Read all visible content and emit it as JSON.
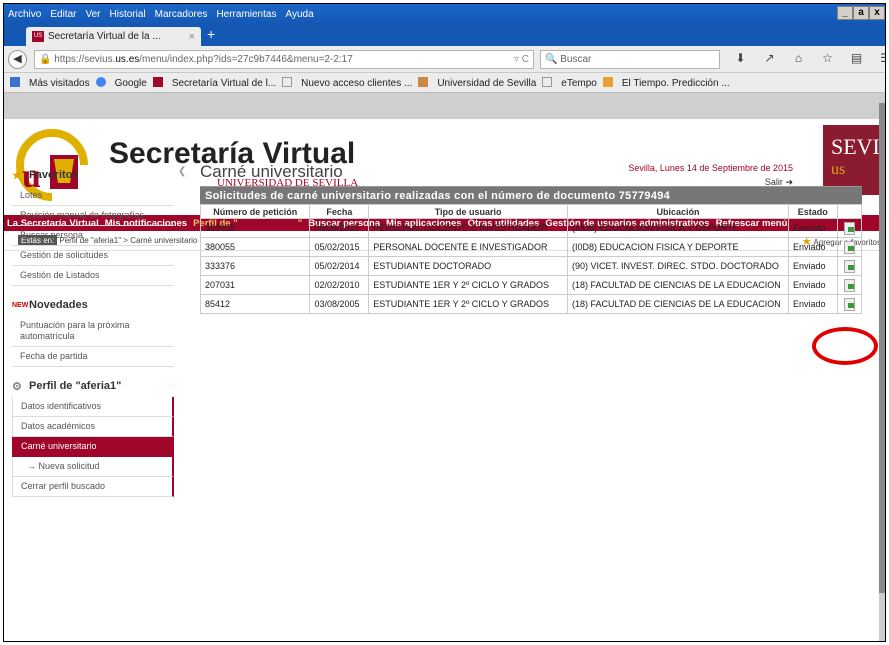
{
  "menubar": {
    "items": [
      "Archivo",
      "Editar",
      "Ver",
      "Historial",
      "Marcadores",
      "Herramientas",
      "Ayuda"
    ],
    "controls": [
      "_",
      "a",
      "x"
    ]
  },
  "tab": {
    "title": "Secretaría Virtual de la ...",
    "close": "×",
    "new": "+"
  },
  "nav": {
    "url_host": "https://sevius.",
    "url_bold": "us.es",
    "url_path": "/menu/index.php?ids=27c9b7446&menu=2-2:17",
    "url_icons": "▿ C",
    "search_placeholder": "Buscar"
  },
  "bookmarks": [
    "Más visitados",
    "Google",
    "Secretaría Virtual de l...",
    "Nuevo acceso clientes ...",
    "Universidad de Sevilla",
    "eTempo",
    "El Tiempo. Predicción ..."
  ],
  "header": {
    "title": "Secretaría Virtual",
    "subtitle": "UNIVERSIDAD DE SEVILLA",
    "date": "Sevilla, Lunes 14 de Septiembre de 2015",
    "salir": "Salir",
    "logo_top": "SEVI",
    "logo_bottom": "us"
  },
  "topnav": {
    "items": [
      "La Secretaría Virtual",
      "Mis notificaciones",
      "Perfil de \"",
      "\"",
      "Buscar persona",
      "Mis aplicaciones",
      "Otras utilidades",
      "Gestión de usuarios administrativos",
      "Refrescar menú"
    ]
  },
  "breadcrumb": {
    "label": "Estás en:",
    "path": "Perfil de \"aferia1\" > Carné universitario",
    "addfav": "Agregar a favoritos"
  },
  "sidebar": {
    "favoritos": {
      "title": "Favoritos",
      "items": [
        "Lotes",
        "Revisión manual de fotografías",
        "Buscar persona",
        "Gestión de solicitudes",
        "Gestión de Listados"
      ]
    },
    "novedades": {
      "title": "Novedades",
      "items": [
        "Puntuación para la próxima automatrícula",
        "Fecha de partida"
      ]
    },
    "perfil": {
      "title": "Perfil de \"aferia1\"",
      "items": [
        "Datos identificativos",
        "Datos académicos",
        "Carné universitario",
        "→ Nueva solicitud",
        "Cerrar perfil buscado"
      ]
    }
  },
  "main": {
    "title": "Carné universitario",
    "table_title": "Solicitudes de carné universitario realizadas con el número de documento 75779494",
    "columns": [
      "Número de petición",
      "Fecha",
      "Tipo de usuario",
      "Ubicación",
      "Estado",
      ""
    ],
    "rows": [
      [
        "369935",
        "09/09/2015",
        "PERSONAL DOCENTE E INVESTIGADOR",
        "(I0D8) EDUCACION FISICA Y DEPORTE",
        "Enviado"
      ],
      [
        "380055",
        "05/02/2015",
        "PERSONAL DOCENTE E INVESTIGADOR",
        "(I0D8) EDUCACION FISICA Y DEPORTE",
        "Enviado"
      ],
      [
        "333376",
        "05/02/2014",
        "ESTUDIANTE DOCTORADO",
        "(90) VICET. INVEST. DIREC. STDO. DOCTORADO",
        "Enviado"
      ],
      [
        "207031",
        "02/02/2010",
        "ESTUDIANTE 1ER Y 2º CICLO Y GRADOS",
        "(18) FACULTAD DE CIENCIAS DE LA EDUCACION",
        "Enviado"
      ],
      [
        "85412",
        "03/08/2005",
        "ESTUDIANTE 1ER Y 2º CICLO Y GRADOS",
        "(18) FACULTAD DE CIENCIAS DE LA EDUCACION",
        "Enviado"
      ]
    ]
  },
  "colors": {
    "brand": "#a0062a",
    "menubar": "#1458b4",
    "highlight": "#e00000"
  }
}
